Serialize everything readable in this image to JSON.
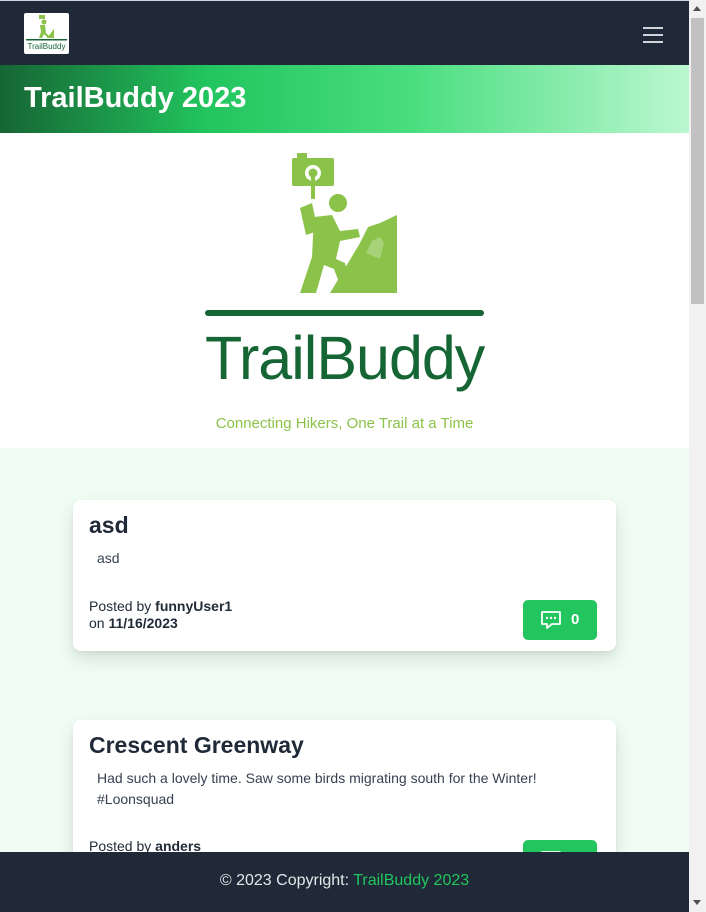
{
  "navbar": {
    "logo_text": "TrailBuddy"
  },
  "banner": {
    "title": "TrailBuddy 2023"
  },
  "hero": {
    "brand": "TrailBuddy",
    "tagline": "Connecting Hikers, One Trail at a Time"
  },
  "posts": [
    {
      "title": "asd",
      "body": "asd",
      "posted_by_label": "Posted by",
      "author": "funnyUser1",
      "on_label": "on",
      "date": "11/16/2023",
      "comments": "0"
    },
    {
      "title": "Crescent Greenway",
      "body": "Had such a lovely time. Saw some birds migrating south for the Winter! #Loonsquad",
      "posted_by_label": "Posted by",
      "author": "anders"
    }
  ],
  "footer": {
    "prefix": "© 2023 Copyright: ",
    "link": "TrailBuddy 2023"
  },
  "colors": {
    "navbar": "#1f2937",
    "accent": "#22c55e",
    "brand_dark": "#166534",
    "brand_light": "#8bc34a",
    "page_bg": "#f0fdf4"
  },
  "icons": [
    "menu-icon",
    "comment-icon",
    "hiker-icon"
  ]
}
